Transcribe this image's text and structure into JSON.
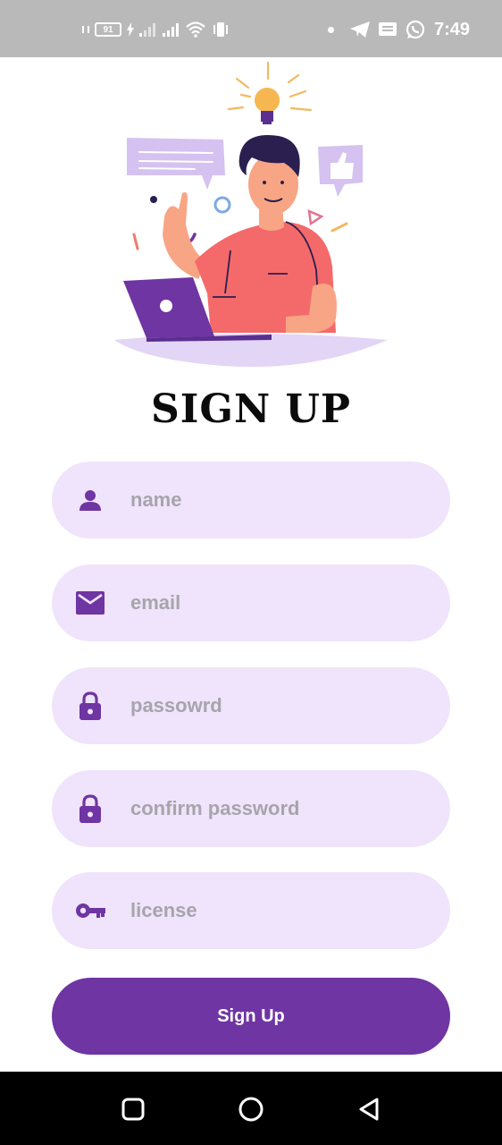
{
  "status_bar": {
    "battery_level": "91",
    "time": "7:49",
    "icons": [
      "vibrate-icon",
      "battery-icon",
      "charging-icon",
      "signal-icon",
      "signal-icon",
      "wifi-icon",
      "vibrate-mode-icon",
      "notification-dot-icon",
      "telegram-icon",
      "message-icon",
      "whatsapp-icon"
    ]
  },
  "header": {
    "title": "SIGN UP"
  },
  "form": {
    "name": {
      "placeholder": "name",
      "icon": "person-icon"
    },
    "email": {
      "placeholder": "email",
      "icon": "mail-icon"
    },
    "password": {
      "placeholder": "passowrd",
      "icon": "lock-icon"
    },
    "confirm_password": {
      "placeholder": "confirm password",
      "icon": "lock-icon"
    },
    "license": {
      "placeholder": "license",
      "icon": "key-icon"
    },
    "submit_label": "Sign Up"
  },
  "colors": {
    "accent": "#6f35a3",
    "field_bg": "#efe4fb",
    "placeholder": "#a7a4ab",
    "status_bar": "#b9b9b9"
  },
  "nav_bar": {
    "buttons": [
      "recent-apps-icon",
      "home-icon",
      "back-icon"
    ]
  }
}
